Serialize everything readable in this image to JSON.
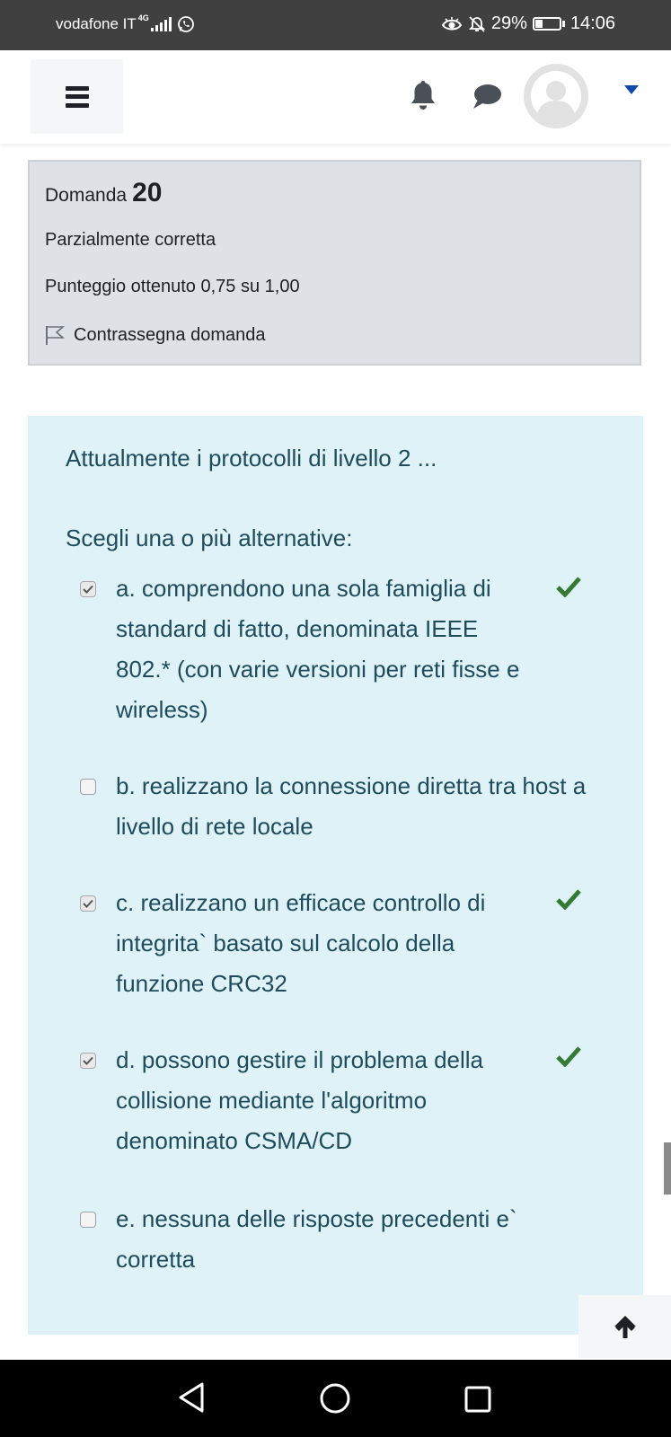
{
  "status_bar": {
    "carrier": "vodafone IT",
    "network": "4G",
    "battery_percent": "29%",
    "battery_level": 0.29,
    "time": "14:06"
  },
  "header": {
    "menu_icon": "hamburger-menu-icon",
    "notification_icon": "bell-icon",
    "messages_icon": "chat-bubble-icon",
    "avatar_icon": "user-avatar-icon",
    "dropdown_icon": "caret-down-icon"
  },
  "question_info": {
    "label": "Domanda",
    "number": "20",
    "state": "Parzialmente corretta",
    "grade": "Punteggio ottenuto 0,75 su 1,00",
    "flag_label": "Contrassegna domanda"
  },
  "question": {
    "text": "Attualmente i protocolli di livello 2 ...",
    "prompt": "Scegli una o più alternative:",
    "answers": [
      {
        "label": "a. comprendono una sola famiglia di standard di fatto, denominata IEEE 802.* (con varie versioni per reti fisse e wireless)",
        "checked": true,
        "correct": true
      },
      {
        "label": "b. realizzano la connessione diretta tra host a livello di rete locale",
        "checked": false,
        "correct": false
      },
      {
        "label": "c. realizzano un efficace controllo di integrita` basato sul calcolo della funzione CRC32",
        "checked": true,
        "correct": true
      },
      {
        "label": "d. possono gestire il problema della collisione mediante l'algoritmo denominato CSMA/CD",
        "checked": true,
        "correct": true
      },
      {
        "label": "e. nessuna delle risposte precedenti e` corretta",
        "checked": false,
        "correct": false
      }
    ]
  },
  "colors": {
    "info_bg": "#dee2e6",
    "content_bg": "#def2f8",
    "content_text": "#1e4c5c",
    "tick_green": "#357a32"
  }
}
